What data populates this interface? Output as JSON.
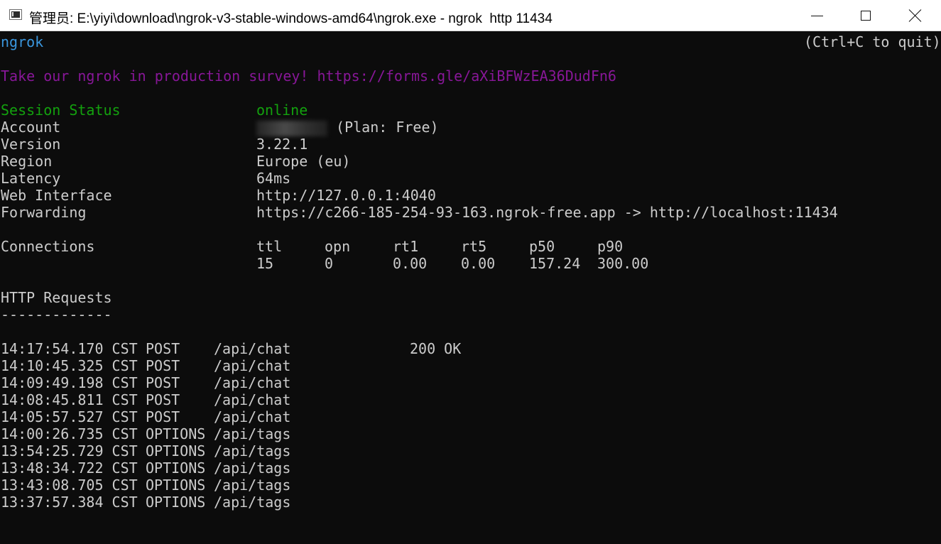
{
  "window": {
    "title": "管理员: E:\\yiyi\\download\\ngrok-v3-stable-windows-amd64\\ngrok.exe - ngrok  http 11434"
  },
  "console": {
    "app_name": "ngrok",
    "quit_hint": "(Ctrl+C to quit)",
    "survey": "Take our ngrok in production survey! https://forms.gle/aXiBFWzEA36DudFn6",
    "status": {
      "session_status_label": "Session Status",
      "session_status_value": "online",
      "account_label": "Account",
      "account_plan": "(Plan: Free)",
      "version_label": "Version",
      "version_value": "3.22.1",
      "region_label": "Region",
      "region_value": "Europe (eu)",
      "latency_label": "Latency",
      "latency_value": "64ms",
      "web_interface_label": "Web Interface",
      "web_interface_value": "http://127.0.0.1:4040",
      "forwarding_label": "Forwarding",
      "forwarding_value": "https://c266-185-254-93-163.ngrok-free.app -> http://localhost:11434"
    },
    "connections": {
      "label": "Connections",
      "headers": [
        "ttl",
        "opn",
        "rt1",
        "rt5",
        "p50",
        "p90"
      ],
      "values": [
        "15",
        "0",
        "0.00",
        "0.00",
        "157.24",
        "300.00"
      ]
    },
    "http_requests": {
      "label": "HTTP Requests",
      "underline": "-------------",
      "rows": [
        {
          "time": "14:17:54.170 CST",
          "method": "POST",
          "path": "/api/chat",
          "status": "200 OK"
        },
        {
          "time": "14:10:45.325 CST",
          "method": "POST",
          "path": "/api/chat",
          "status": ""
        },
        {
          "time": "14:09:49.198 CST",
          "method": "POST",
          "path": "/api/chat",
          "status": ""
        },
        {
          "time": "14:08:45.811 CST",
          "method": "POST",
          "path": "/api/chat",
          "status": ""
        },
        {
          "time": "14:05:57.527 CST",
          "method": "POST",
          "path": "/api/chat",
          "status": ""
        },
        {
          "time": "14:00:26.735 CST",
          "method": "OPTIONS",
          "path": "/api/tags",
          "status": ""
        },
        {
          "time": "13:54:25.729 CST",
          "method": "OPTIONS",
          "path": "/api/tags",
          "status": ""
        },
        {
          "time": "13:48:34.722 CST",
          "method": "OPTIONS",
          "path": "/api/tags",
          "status": ""
        },
        {
          "time": "13:43:08.705 CST",
          "method": "OPTIONS",
          "path": "/api/tags",
          "status": ""
        },
        {
          "time": "13:37:57.384 CST",
          "method": "OPTIONS",
          "path": "/api/tags",
          "status": ""
        }
      ]
    }
  }
}
